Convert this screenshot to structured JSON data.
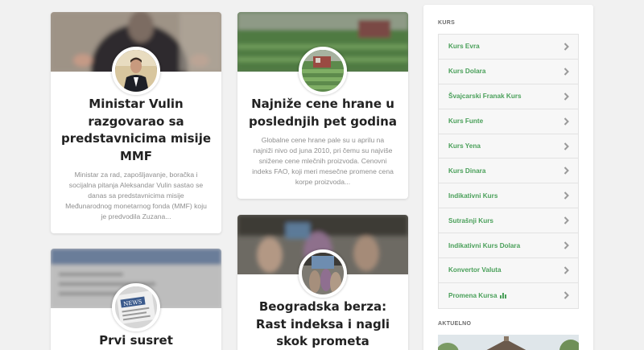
{
  "cards": [
    {
      "title": "Ministar Vulin razgovarao sa predstavnicima misije MMF",
      "excerpt": "Ministar za rad, zapošljavanje, boračka i socijalna pitanja Aleksandar Vulin sastao se danas sa predstavnicima misije Međunarodnog monetarnog fonda (MMF) koju je predvodila Zuzana..."
    },
    {
      "title": "Najniže cene hrane u poslednjih pet godina",
      "excerpt": "Globalne cene hrane pale su u aprilu na najniži nivo od juna 2010, pri čemu su najviše snižene cene mlečnih proizvoda. Cenovni indeks FAO, koji meri mesečne promene cena korpe proizvoda..."
    },
    {
      "title": "Prvi susret privrednika",
      "excerpt": ""
    },
    {
      "title": "Beogradska berza: Rast indeksa i nagli skok prometa",
      "excerpt": ""
    }
  ],
  "sidebar": {
    "kurs_title": "KURS",
    "kurs_items": [
      {
        "label": "Kurs Evra"
      },
      {
        "label": "Kurs Dolara"
      },
      {
        "label": "Švajcarski Franak Kurs"
      },
      {
        "label": "Kurs Funte"
      },
      {
        "label": "Kurs Yena"
      },
      {
        "label": "Kurs Dinara"
      },
      {
        "label": "Indikativni Kurs"
      },
      {
        "label": "Sutrašnji Kurs"
      },
      {
        "label": "Indikativni Kurs Dolara"
      },
      {
        "label": "Konvertor Valuta"
      },
      {
        "label": "Promena Kursa",
        "icon": "bar-chart-icon"
      }
    ],
    "aktuelno_title": "AKTUELNO"
  },
  "colors": {
    "accent": "#4aa05a",
    "title": "#222222",
    "excerpt": "#8f8f8f"
  }
}
